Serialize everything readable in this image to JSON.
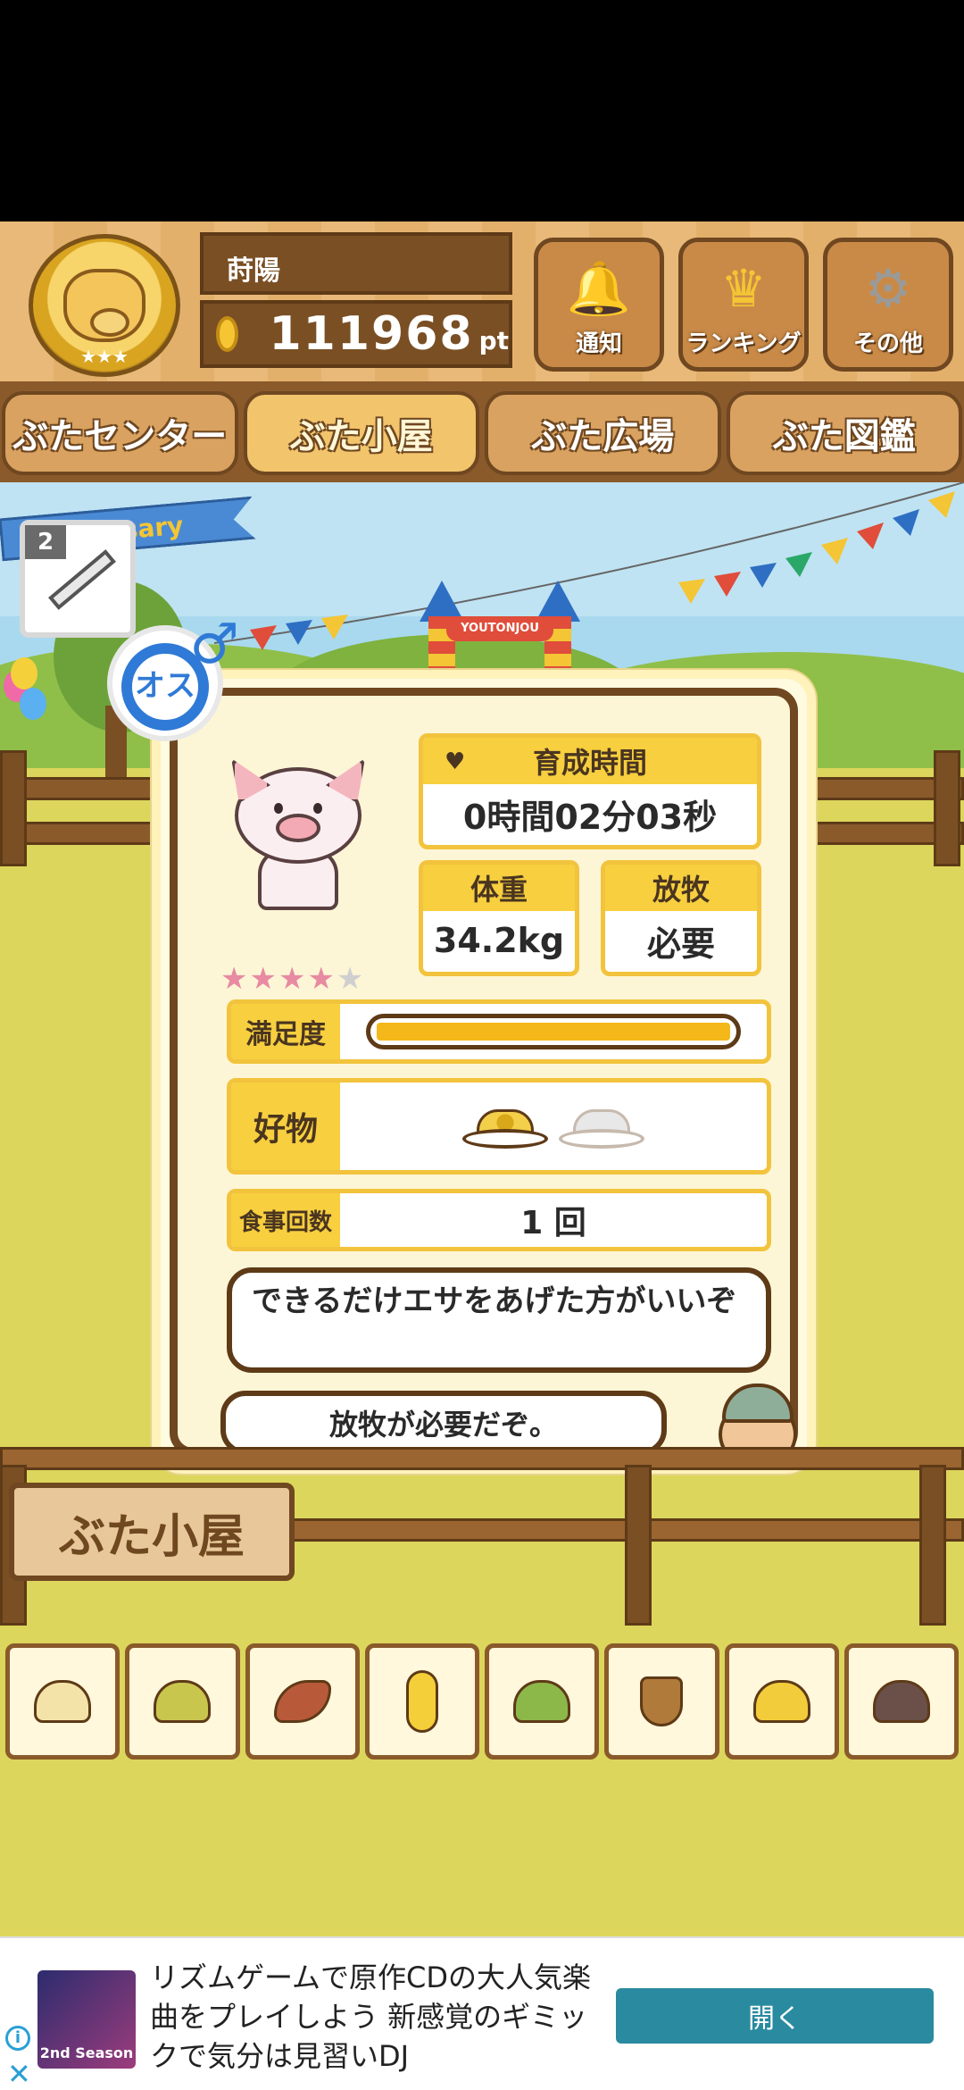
{
  "header": {
    "player_name": "莳陽",
    "points": "111968",
    "points_unit": "pt",
    "buttons": [
      {
        "label": "通知",
        "icon": "bell-icon",
        "glyph": "🔔"
      },
      {
        "label": "ランキング",
        "icon": "crown-icon",
        "glyph": "♛"
      },
      {
        "label": "その他",
        "icon": "gear-icon",
        "glyph": "⚙"
      }
    ]
  },
  "tabs": [
    {
      "label": "ぶたセンター",
      "active": false
    },
    {
      "label": "ぶた小屋",
      "active": true
    },
    {
      "label": "ぶた広場",
      "active": false
    },
    {
      "label": "ぶた図鑑",
      "active": false
    }
  ],
  "event": {
    "ribbon_text": "...ersary",
    "item_count": "2",
    "item_icon": "syringe-icon"
  },
  "gate_sign": "YOUTONJOU",
  "pig": {
    "gender_label": "オス",
    "gender_symbol": "♂",
    "rating": 4,
    "rating_max": 5,
    "raising_time_label": "育成時間",
    "raising_time_value": "0時間02分03秒",
    "weight_label": "体重",
    "weight_value": "34.2kg",
    "grazing_label": "放牧",
    "grazing_value": "必要",
    "satisfaction_label": "満足度",
    "satisfaction_level": 1.0,
    "favorite_label": "好物",
    "favorite_foods": [
      "corn-dish-icon",
      "rice-ball-dish-icon"
    ],
    "meal_count_label": "食事回数",
    "meal_count_value": "1 回"
  },
  "speech": {
    "message_1": "できるだけエサをあげた方がいいぞ",
    "message_2": "放牧が必要だぞ。"
  },
  "location_sign": "ぶた小屋",
  "food_tray": [
    {
      "icon": "soybean-icon",
      "color": "#f3e3a8"
    },
    {
      "icon": "mixed-grain-icon",
      "color": "#c9c64e"
    },
    {
      "icon": "sweet-potato-icon",
      "color": "#b85a3a"
    },
    {
      "icon": "corn-icon",
      "color": "#f4cf3a"
    },
    {
      "icon": "leaf-beans-icon",
      "color": "#8cb84a"
    },
    {
      "icon": "acorn-icon",
      "color": "#b07a3a"
    },
    {
      "icon": "corn-dish-icon",
      "color": "#f2cc3a"
    },
    {
      "icon": "rice-ball-dish-icon",
      "color": "#6a5048"
    }
  ],
  "ad": {
    "text": "リズムゲームで原作CDの大人気楽曲をプレイしよう 新感覚のギミックで気分は見習いDJ",
    "image_caption": "2nd Season",
    "button_label": "開く",
    "info_glyph": "i",
    "close_glyph": "✕"
  }
}
